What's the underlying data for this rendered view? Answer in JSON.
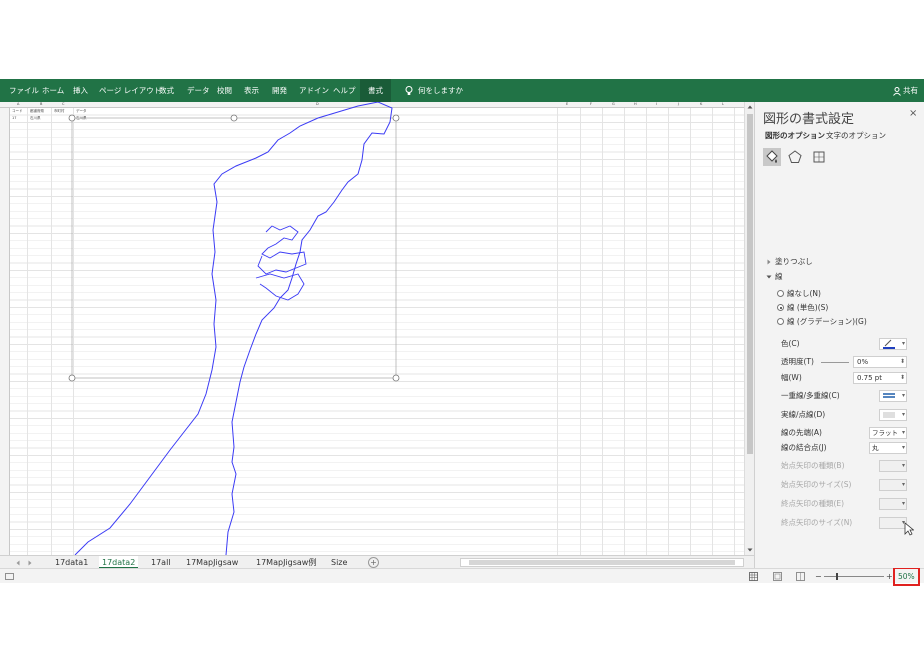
{
  "ribbon": {
    "tabs": [
      "ファイル",
      "ホーム",
      "挿入",
      "ページ レイアウト",
      "数式",
      "データ",
      "校閲",
      "表示",
      "開発",
      "アドイン",
      "ヘルプ",
      "書式"
    ],
    "active_tab": "書式",
    "tell_me": "何をしますか",
    "share": "共有",
    "accent": "#217346"
  },
  "sheet": {
    "columns": [
      "A",
      "B",
      "C",
      "D",
      "E",
      "F",
      "G",
      "H",
      "I",
      "J",
      "K",
      "L",
      "M",
      "N",
      "O",
      "P",
      "Q",
      "R",
      "S",
      "T"
    ],
    "header_row_1": [
      "コード",
      "都道府県",
      "市町村",
      "データ"
    ],
    "header_row_2": [
      "17",
      "石川県",
      "",
      "石川県"
    ],
    "shape_color": "#3b3bf5"
  },
  "sheet_tabs": {
    "tabs": [
      "17data1",
      "17data2",
      "17all",
      "17MapJigsaw",
      "17MapJigsaw例",
      "Size"
    ],
    "active": "17data2",
    "add_label": "+"
  },
  "status": {
    "zoom_minus": "−",
    "zoom_plus": "+",
    "zoom": "50%",
    "zoom_level_percent": 50
  },
  "pane": {
    "title": "図形の書式設定",
    "close": "×",
    "tab_shape_options": "図形のオプション",
    "tab_text_options": "文字のオプション",
    "section_fill": "塗りつぶし",
    "section_line": "線",
    "radio_no_line": "線なし(N)",
    "radio_solid": "線 (単色)(S)",
    "radio_gradient": "線 (グラデーション)(G)",
    "color_label": "色(C)",
    "transparency_label": "透明度(T)",
    "transparency_value": "0%",
    "width_label": "幅(W)",
    "width_value": "0.75 pt",
    "compound_label": "一重線/多重線(C)",
    "dash_label": "実線/点線(D)",
    "cap_label": "線の先端(A)",
    "cap_value": "フラット",
    "join_label": "線の結合点(J)",
    "join_value": "丸",
    "begin_arrow_type": "始点矢印の種類(B)",
    "begin_arrow_size": "始点矢印のサイズ(S)",
    "end_arrow_type": "終点矢印の種類(E)",
    "end_arrow_size": "終点矢印のサイズ(N)",
    "line_color": "#1f3fbf"
  }
}
